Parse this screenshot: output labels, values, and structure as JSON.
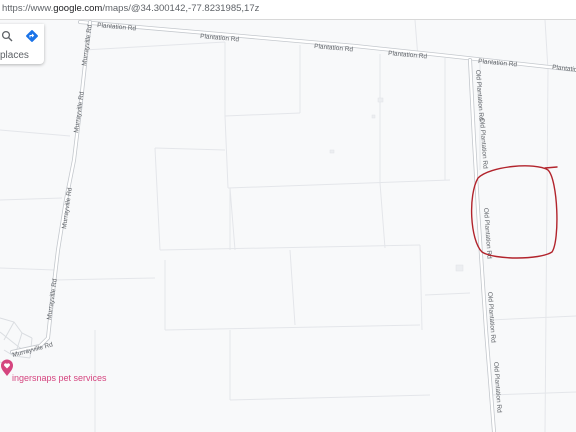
{
  "browser": {
    "url_prefix": "https://www.",
    "url_domain": "google.com",
    "url_suffix": "/maps/@34.300142,-77.8231985,17z"
  },
  "panel": {
    "places_label": "places",
    "search_icon": "search-icon",
    "directions_icon": "directions-icon"
  },
  "roads": {
    "plantation_1": "Plantation Rd",
    "plantation_2": "Plantation Rd",
    "plantation_3": "Plantation Rd",
    "plantation_4": "Plantation Rd",
    "plantation_5": "Plantation Rd",
    "plantation_6": "Plantation Rd",
    "murrayville_1": "Murrayville Rd",
    "murrayville_2": "Murrayville Rd",
    "murrayville_3": "Murrayville Rd",
    "murrayville_4": "Murrayville Rd",
    "old_plantation_1": "Old Plantation Rd",
    "old_plantation_2": "Old Plantation Rd",
    "old_plantation_3": "Old Plantation Rd",
    "old_plantation_4": "Old Plantation Rd",
    "old_plantation_5": "Old Plantation Rd"
  },
  "poi": {
    "label": "ingersnaps pet services",
    "icon": "heart-pin-icon",
    "color": "#d5457f"
  },
  "annotation": {
    "color": "#b2242c"
  },
  "colors": {
    "land": "#f8f9fa",
    "parcel_line": "#e4e6ea",
    "road_fill": "#ffffff",
    "road_casing": "#c4c8cd",
    "road_label": "#5f6368"
  }
}
